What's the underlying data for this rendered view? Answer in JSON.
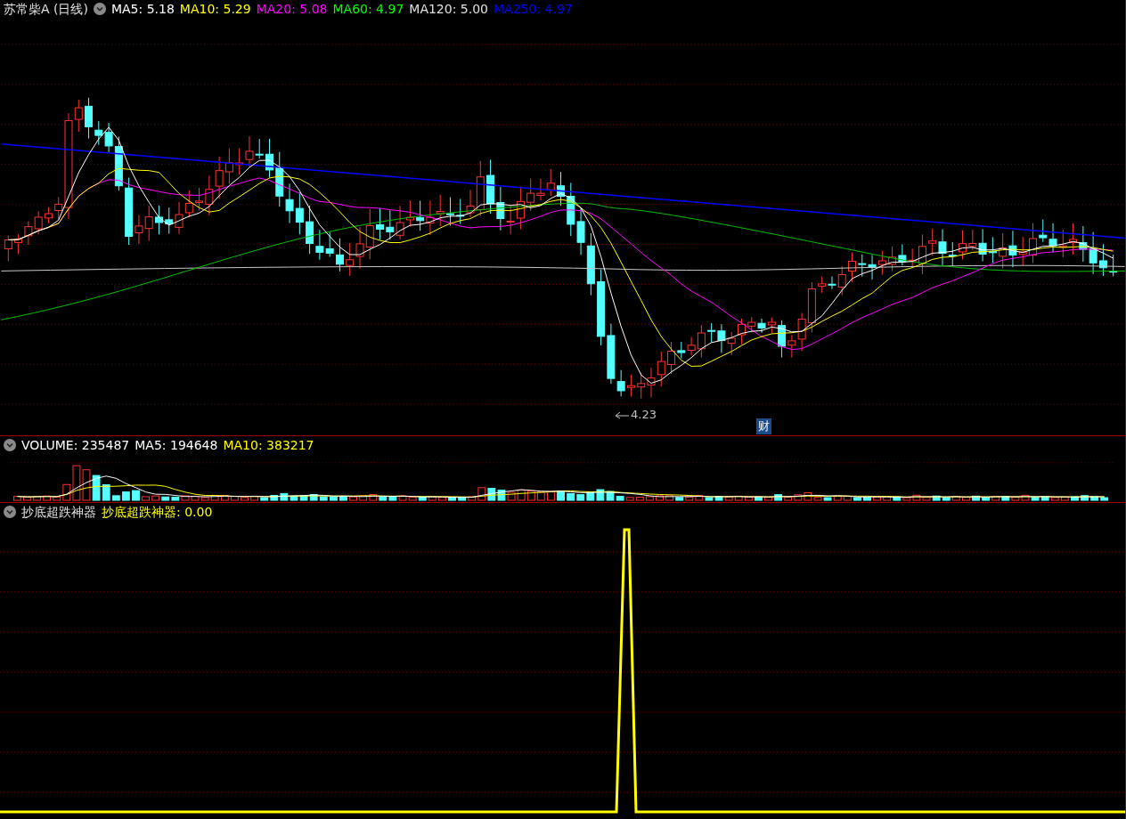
{
  "main_panel": {
    "title": "苏常柴A (日线)",
    "indicators": [
      {
        "label": "MA5: 5.18",
        "color": "#ffffff"
      },
      {
        "label": "MA10: 5.29",
        "color": "#ffff00"
      },
      {
        "label": "MA20: 5.08",
        "color": "#ff00ff"
      },
      {
        "label": "MA60: 4.97",
        "color": "#00ff00"
      },
      {
        "label": "MA120: 5.00",
        "color": "#e0e0e0"
      },
      {
        "label": "MA250: 4.97",
        "color": "#0000ff"
      }
    ],
    "low_label": "4.23",
    "event_badge": "财"
  },
  "volume_panel": {
    "indicators": [
      {
        "label": "VOLUME: 235487",
        "color": "#ffffff"
      },
      {
        "label": "MA5: 194648",
        "color": "#ffffff"
      },
      {
        "label": "MA10: 383217",
        "color": "#ffff00"
      }
    ]
  },
  "signal_panel": {
    "title": "抄底超跌神器",
    "indicators": [
      {
        "label": "抄底超跌神器: 0.00",
        "color": "#ffff00"
      }
    ]
  }
}
